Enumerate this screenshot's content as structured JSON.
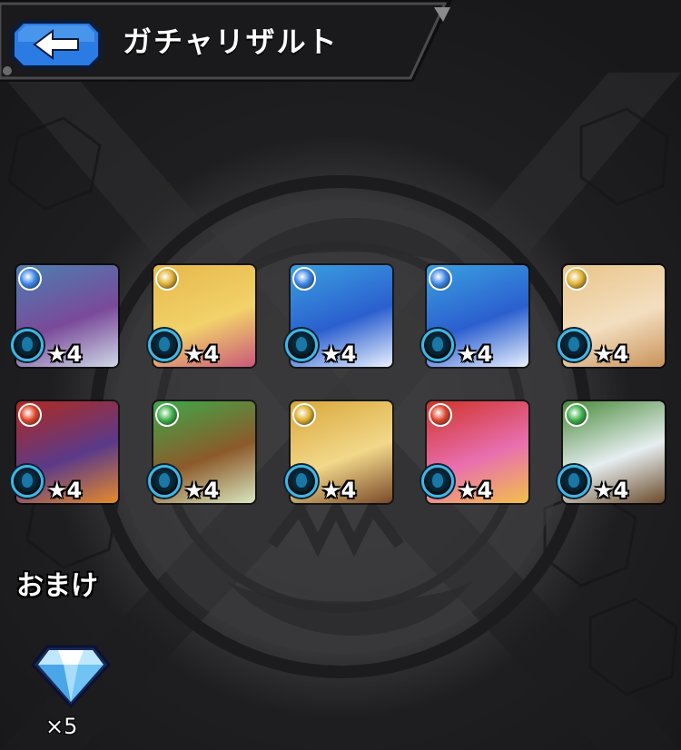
{
  "header": {
    "title": "ガチャリザルト",
    "back_icon": "back-arrow-icon"
  },
  "results": [
    {
      "rarity_label": "★4",
      "attribute": "water",
      "attr_color": "#3a86e8",
      "art_colors": [
        "#4b7fb0",
        "#7a4a9a",
        "#cfd9e6"
      ]
    },
    {
      "rarity_label": "★4",
      "attribute": "light",
      "attr_color": "#e0b030",
      "art_colors": [
        "#e6b84a",
        "#f2d26a",
        "#c9587a"
      ]
    },
    {
      "rarity_label": "★4",
      "attribute": "water",
      "attr_color": "#3a86e8",
      "art_colors": [
        "#3aa0e0",
        "#2b5fcf",
        "#e9f1ff"
      ]
    },
    {
      "rarity_label": "★4",
      "attribute": "water",
      "attr_color": "#3a86e8",
      "art_colors": [
        "#3aa0e0",
        "#2b5fcf",
        "#e9f1ff"
      ]
    },
    {
      "rarity_label": "★4",
      "attribute": "light",
      "attr_color": "#e0b030",
      "art_colors": [
        "#e9c48a",
        "#f3dfc0",
        "#c9925a"
      ]
    },
    {
      "rarity_label": "★4",
      "attribute": "fire",
      "attr_color": "#e0452a",
      "art_colors": [
        "#b12a1e",
        "#5b3a8a",
        "#e58a2a"
      ]
    },
    {
      "rarity_label": "★4",
      "attribute": "wood",
      "attr_color": "#3fb04a",
      "art_colors": [
        "#3ea84a",
        "#8c5a2a",
        "#d9e6c0"
      ]
    },
    {
      "rarity_label": "★4",
      "attribute": "light",
      "attr_color": "#e0b030",
      "art_colors": [
        "#d9a73a",
        "#f2d88a",
        "#7a4a2a"
      ]
    },
    {
      "rarity_label": "★4",
      "attribute": "fire",
      "attr_color": "#e0452a",
      "art_colors": [
        "#d0342a",
        "#e86fb0",
        "#f2c04a"
      ]
    },
    {
      "rarity_label": "★4",
      "attribute": "wood",
      "attr_color": "#3fb04a",
      "art_colors": [
        "#4a8a3a",
        "#e6eef0",
        "#6a4a2a"
      ]
    }
  ],
  "bonus": {
    "label": "おまけ",
    "item_icon": "gem-icon",
    "count": "×5"
  },
  "colors": {
    "background": "#2a2a2c",
    "header_bg": "#1a1a1c",
    "back_button": "#2a7be4",
    "orb_ring": "#3fb6e6"
  }
}
